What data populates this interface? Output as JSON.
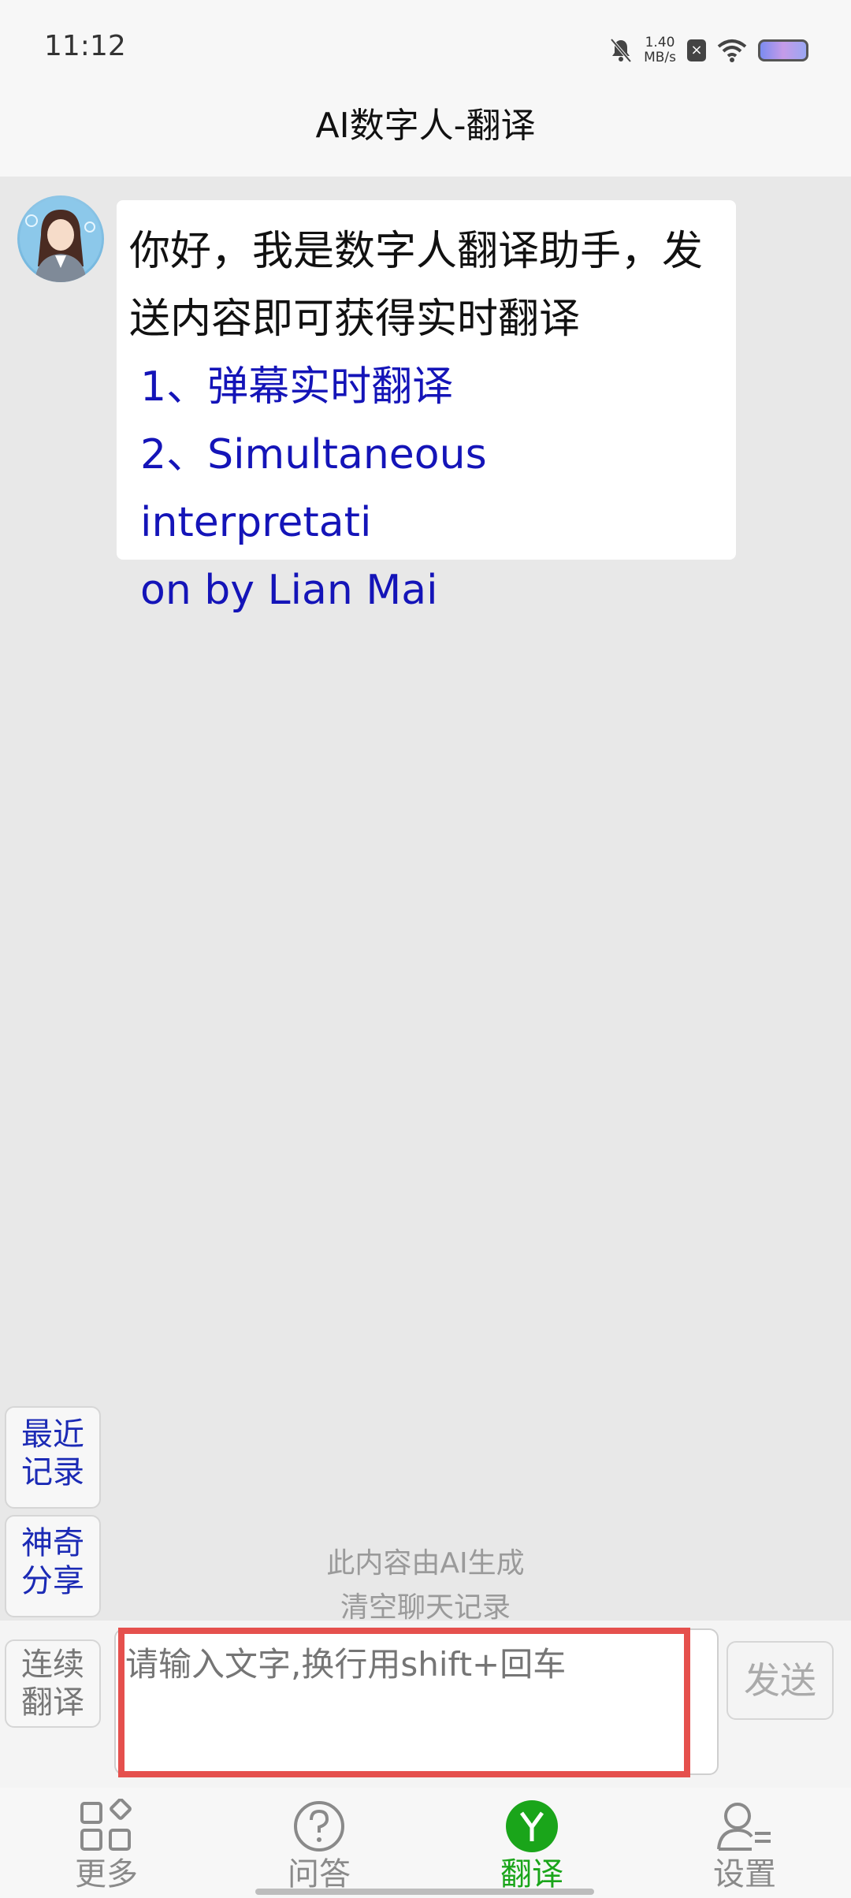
{
  "status": {
    "time": "11:12",
    "net_speed_value": "1.40",
    "net_speed_unit": "MB/s"
  },
  "header": {
    "title": "AI数字人-翻译"
  },
  "chat": {
    "greeting_line1": "你好，我是数字人翻译助手，发",
    "greeting_line2": "送内容即可获得实时翻译",
    "option1": "1、弹幕实时翻译",
    "option2_line1": "2、Simultaneous interpretati",
    "option2_line2": "on by Lian Mai"
  },
  "side_buttons": {
    "recent_line1": "最近",
    "recent_line2": "记录",
    "share_line1": "神奇",
    "share_line2": "分享",
    "continuous_line1": "连续",
    "continuous_line2": "翻译"
  },
  "notes": {
    "ai_generated": "此内容由AI生成",
    "clear_history": "清空聊天记录"
  },
  "composer": {
    "placeholder": "请输入文字,换行用shift+回车",
    "send_label": "发送"
  },
  "tabs": [
    {
      "label": "更多",
      "icon": "grid-icon",
      "active": false
    },
    {
      "label": "问答",
      "icon": "question-icon",
      "active": false
    },
    {
      "label": "翻译",
      "icon": "translate-y-icon",
      "active": true
    },
    {
      "label": "设置",
      "icon": "user-settings-icon",
      "active": false
    }
  ],
  "colors": {
    "accent_green": "#1aa51a",
    "link_blue": "#1414b8",
    "highlight_red": "#e5504d"
  }
}
